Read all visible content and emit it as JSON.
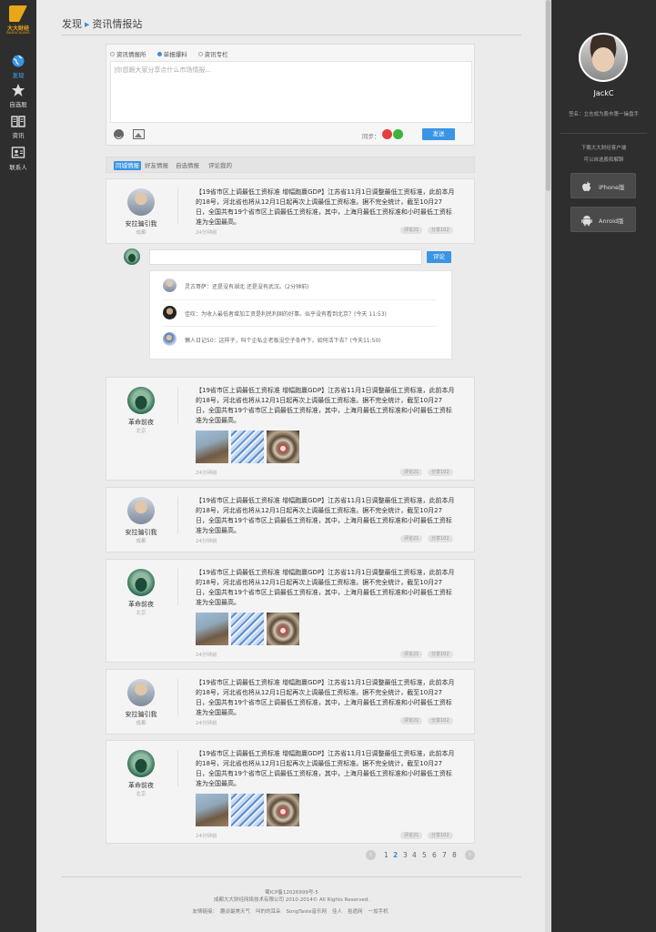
{
  "brand": {
    "name": "大大财经",
    "sub": "DADACAIJING",
    "color": "#e6a817"
  },
  "accent": "#3a95e4",
  "leftnav": [
    {
      "icon": "globe-icon",
      "label": "发现",
      "active": true
    },
    {
      "icon": "star-icon",
      "label": "自选股",
      "active": false
    },
    {
      "icon": "book-icon",
      "label": "资讯",
      "active": false
    },
    {
      "icon": "contact-card-icon",
      "label": "联系人",
      "active": false
    }
  ],
  "breadcrumb": {
    "root": "发现",
    "current": "资讯情报站"
  },
  "composer": {
    "tabs": [
      "资讯情报所",
      "单报爆料",
      "资讯专栏"
    ],
    "active_tab": 1,
    "placeholder": "|你想跟大家分享点什么市场情报...",
    "sync_label": "同步：",
    "send_label": "发送"
  },
  "feed_tabs": [
    "同城情报",
    "好友情报",
    "自选情报",
    "评论我的"
  ],
  "post_text": "【19省市区上调最低工资标准 增幅跑赢GDP】江苏省11月1日调整最低工资标准，此前本月的18号，河北省也将从12月1日起再次上调最低工资标准。据不完全统计，截至10月27日，全国共有19个省市区上调最低工资标准，其中，上海月最低工资标准和小时最低工资标准为全国最高。",
  "posts": [
    {
      "user": "安拉骗引我",
      "location": "成都",
      "time": "24分钟前",
      "comment": "评论21",
      "share": "分享102",
      "avatar": "av1",
      "images": false
    },
    {
      "user": "革命前夜",
      "location": "北京",
      "time": "24分钟前",
      "comment": "评论21",
      "share": "分享102",
      "avatar": "av2",
      "images": true
    },
    {
      "user": "安拉骗引我",
      "location": "成都",
      "time": "24分钟前",
      "comment": "评论21",
      "share": "分享102",
      "avatar": "av1",
      "images": false
    },
    {
      "user": "革命前夜",
      "location": "北京",
      "time": "24分钟前",
      "comment": "评论21",
      "share": "分享102",
      "avatar": "av2",
      "images": true
    },
    {
      "user": "安拉骗引我",
      "location": "成都",
      "time": "24分钟前",
      "comment": "评论21",
      "share": "分享102",
      "avatar": "av1",
      "images": false
    },
    {
      "user": "革命前夜",
      "location": "北京",
      "time": "24分钟前",
      "comment": "评论21",
      "share": "分享102",
      "avatar": "av2",
      "images": true
    }
  ],
  "reply": {
    "button": "评论",
    "comments": [
      {
        "text": "灵古哥萨：还是没有湖北 还是没有武汉。(2分钟前)"
      },
      {
        "text": "佳叹：为收入最低者增加工资是利民利国的好事。似乎没有看到北京？(今天 11:53)"
      },
      {
        "text": "懒人日记50：这样子，叫个企私企老板没空子条件下。如何活下去？(今天11:50)"
      }
    ]
  },
  "pager": {
    "prev": "‹",
    "next": "›",
    "pages": [
      "1",
      "2",
      "3",
      "4",
      "5",
      "6",
      "7",
      "8"
    ],
    "current": "2"
  },
  "footer": {
    "icp": "蜀ICP备12026999号-5",
    "copyright": "成都大大财经网络技术有限公司 2010-2014© All Rights Reserved.",
    "links_label": "友情链接：",
    "links": [
      "趣谈最美天气",
      "叫的的耳朵",
      "SongTaste音乐网",
      "佳人",
      "拾遗网",
      "一加手机"
    ]
  },
  "profile": {
    "name": "JackC",
    "signature": "签名：立志成为股市第一操盘手",
    "download_line1": "下载大大财经客户端",
    "download_line2": "可以自选股和解聊",
    "apps": [
      {
        "icon": "apple-icon",
        "label": "iPhone版"
      },
      {
        "icon": "android-icon",
        "label": "Anroid版"
      }
    ]
  }
}
